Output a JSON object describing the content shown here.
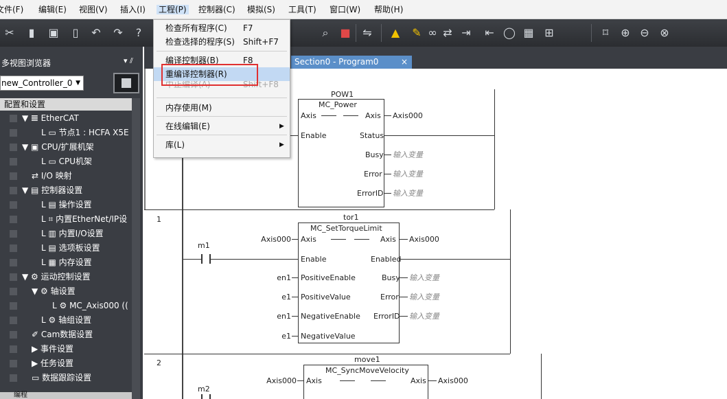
{
  "menubar": {
    "items": [
      "文件(F)",
      "编辑(E)",
      "视图(V)",
      "插入(I)",
      "工程(P)",
      "控制器(C)",
      "模拟(S)",
      "工具(T)",
      "窗口(W)",
      "帮助(H)"
    ],
    "active_index": 4
  },
  "toolbar": {
    "icons": [
      "cut-icon",
      "copy-icon",
      "paste-icon",
      "delete-icon",
      "undo-icon",
      "redo-icon",
      "help-icon",
      "find-icon",
      "register-icon",
      "compare-icon",
      "warning-icon",
      "pencil-icon",
      "online-icon",
      "sync-icon",
      "transfer-icon",
      "upload-icon",
      "stop-icon",
      "monitor-icon",
      "cross-ref-icon",
      "fit-icon",
      "zoom-in-icon",
      "zoom-out-icon",
      "zoom-reset-icon"
    ]
  },
  "left_panel": {
    "title": "多视图浏览器",
    "pin": "▾ ⫽",
    "controller": "new_Controller_0",
    "section": "配置和设置",
    "tree": [
      {
        "label": "▼ 𝌆 EtherCAT"
      },
      {
        "label": "L ▭ 节点1 : HCFA X5E"
      },
      {
        "label": "▼ ▣ CPU/扩展机架"
      },
      {
        "label": "L ▭ CPU机架"
      },
      {
        "label": "⇄ I/O 映射"
      },
      {
        "label": "▼ ▤ 控制器设置"
      },
      {
        "label": "L ▤ 操作设置"
      },
      {
        "label": "L ⌗ 内置EtherNet/IP设"
      },
      {
        "label": "L ▥ 内置I/O设置"
      },
      {
        "label": "L ▤ 选项板设置"
      },
      {
        "label": "L ▦ 内存设置"
      },
      {
        "label": "▼ ⚙ 运动控制设置"
      },
      {
        "label": "▼ ⚙ 轴设置"
      },
      {
        "label": "L ⚙ MC_Axis000 (("
      },
      {
        "label": "L ⚙ 轴组设置"
      },
      {
        "label": "✐ Cam数据设置"
      },
      {
        "label": "▶ 事件设置"
      },
      {
        "label": "▶ 任务设置"
      },
      {
        "label": "▭ 数据跟踪设置"
      }
    ],
    "bottom": "编程"
  },
  "tabs": {
    "active": "Section0 - Program0",
    "close": "×"
  },
  "dropdown": {
    "items": [
      {
        "label": "检查所有程序(C)",
        "shortcut": "F7"
      },
      {
        "label": "检查选择的程序(S)",
        "shortcut": "Shift+F7"
      },
      {
        "label": "编译控制器(B)",
        "shortcut": "F8"
      },
      {
        "label": "重编译控制器(R)",
        "shortcut": ""
      },
      {
        "label": "中止编译(A)",
        "shortcut": "Shift+F8"
      },
      {
        "label": "内存使用(M)",
        "shortcut": ""
      },
      {
        "label": "在线编辑(E)",
        "shortcut": "",
        "arrow": "▶"
      },
      {
        "label": "库(L)",
        "shortcut": "",
        "arrow": "▶"
      }
    ]
  },
  "ladder": {
    "rung0": {
      "instance": "POW1",
      "fb": "MC_Power",
      "in_axis": "Axis",
      "out_axis": "Axis",
      "out_axis_var": "Axis000",
      "in_enable": "Enable",
      "out_status": "Status",
      "out_busy": "Busy",
      "out_busy_var": "输入变量",
      "out_error": "Error",
      "out_error_var": "输入变量",
      "out_errorid": "ErrorID",
      "out_errorid_var": "输入变量"
    },
    "rung1": {
      "num": "1",
      "instance": "tor1",
      "fb": "MC_SetTorqueLimit",
      "in_axis_var": "Axis000",
      "in_axis": "Axis",
      "out_axis": "Axis",
      "out_axis_var": "Axis000",
      "contact": "m1",
      "in_enable": "Enable",
      "out_enabled": "Enabled",
      "in_pe_var": "en1",
      "in_pe": "PositiveEnable",
      "out_busy": "Busy",
      "out_busy_var": "输入变量",
      "in_pv_var": "e1",
      "in_pv": "PositiveValue",
      "out_error": "Error",
      "out_error_var": "输入变量",
      "in_ne_var": "en1",
      "in_ne": "NegativeEnable",
      "out_errorid": "ErrorID",
      "out_errorid_var": "输入变量",
      "in_nv_var": "e1",
      "in_nv": "NegativeValue"
    },
    "rung2": {
      "num": "2",
      "instance": "move1",
      "fb": "MC_SyncMoveVelocity",
      "in_axis_var": "Axis000",
      "in_axis": "Axis",
      "out_axis": "Axis",
      "out_axis_var": "Axis000",
      "contact": "m2"
    }
  }
}
